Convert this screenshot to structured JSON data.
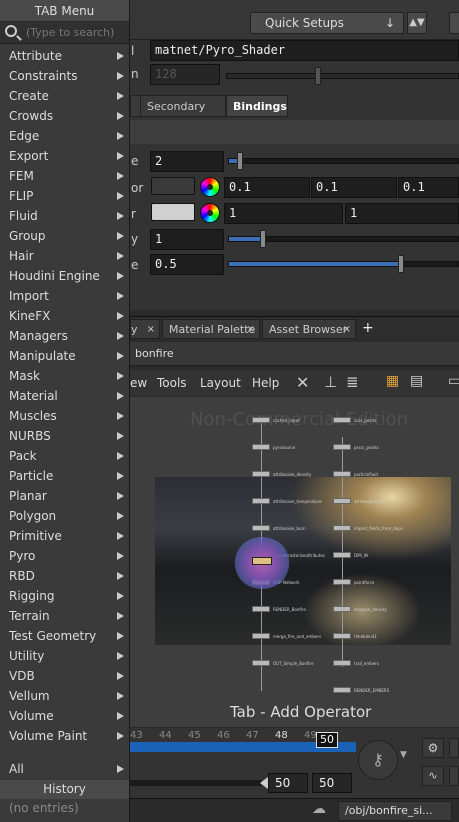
{
  "toolbar": {
    "quick_setups": "Quick Setups"
  },
  "params": {
    "shop_path_label": "l",
    "shop_path": "matnet/Pyro_Shader",
    "disabled_value": "128",
    "disabled_label": "n",
    "tabs": [
      "Secondary Fire",
      "Bindings"
    ],
    "rows": [
      {
        "label": "e",
        "value": "2",
        "slider_fraction": 0.05
      },
      {
        "label": "or",
        "values": [
          "0.1",
          "0.1",
          "0.1"
        ]
      },
      {
        "label": "r",
        "values": [
          "1",
          "1"
        ]
      },
      {
        "label": "y",
        "value": "1",
        "slider_fraction": 0.15
      },
      {
        "label": "e",
        "value": "0.5",
        "slider_fraction": 0.75
      }
    ],
    "colors": {
      "swatch_dark": "#3a3a3a",
      "swatch_light": "#d0d0d0"
    }
  },
  "pane_tabs": [
    {
      "label": "y"
    },
    {
      "label": "Material Palette"
    },
    {
      "label": "Asset Browser"
    }
  ],
  "path_bar": {
    "current": "bonfire"
  },
  "network_menu": [
    "ew",
    "Tools",
    "Layout",
    "Help"
  ],
  "network": {
    "watermark": "Non-Commercial Edition",
    "hint": "Tab - Add Operator",
    "nodes_left": [
      "cached_input",
      "pyrosource",
      "attribnoise_density",
      "attribnoise_temperature",
      "attribnoise_burn",
      "volumerasterizeattributes",
      "DOP Network",
      "RENDER_Bonfire",
      "merge_fire_and_embers",
      "OUT_Simple_Bonfire"
    ],
    "nodes_right": [
      "scat_points",
      "pssrc_points",
      "particlefluid",
      "attribadjust_life",
      "import_fields_from_dops",
      "DIM_IN",
      "pointforce",
      "sharpen_density",
      "timeblend1",
      "trail_embers",
      "RENDER_EMBERS"
    ]
  },
  "timeline": {
    "ticks": [
      "43",
      "44",
      "45",
      "46",
      "47",
      "48",
      "49"
    ],
    "current_frame": "50",
    "range_end_1": "50",
    "range_end_2": "50"
  },
  "status": {
    "path": "/obj/bonfire_si..."
  },
  "tab_menu": {
    "title": "TAB Menu",
    "search_placeholder": "(Type to search)",
    "items": [
      "Attribute",
      "Constraints",
      "Create",
      "Crowds",
      "Edge",
      "Export",
      "FEM",
      "FLIP",
      "Fluid",
      "Group",
      "Hair",
      "Houdini Engine",
      "Import",
      "KineFX",
      "Managers",
      "Manipulate",
      "Mask",
      "Material",
      "Muscles",
      "NURBS",
      "Pack",
      "Particle",
      "Planar",
      "Polygon",
      "Primitive",
      "Pyro",
      "RBD",
      "Rigging",
      "Terrain",
      "Test Geometry",
      "Utility",
      "VDB",
      "Vellum",
      "Volume",
      "Volume Paint"
    ],
    "all_label": "All",
    "history_label": "History",
    "no_entries": "(no entries)"
  }
}
